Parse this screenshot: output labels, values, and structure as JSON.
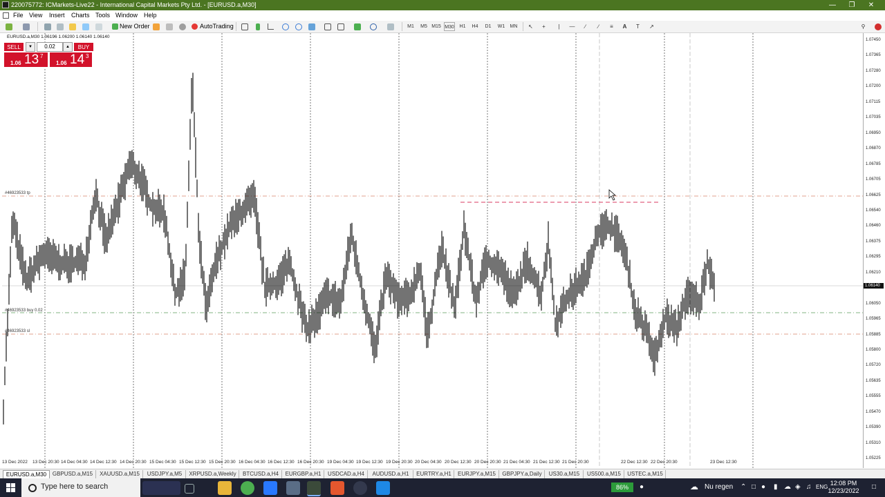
{
  "window": {
    "title": "220075772: ICMarkets-Live22 - International Capital Markets Pty Ltd. - [EURUSD.a,M30]"
  },
  "menu": [
    "File",
    "View",
    "Insert",
    "Charts",
    "Tools",
    "Window",
    "Help"
  ],
  "toolbar": {
    "new_order_label": "New Order",
    "autotrading_label": "AutoTrading",
    "timeframes": [
      "M1",
      "M5",
      "M15",
      "M30",
      "H1",
      "H4",
      "D1",
      "W1",
      "MN"
    ],
    "text_tool_label": "A"
  },
  "chart": {
    "symbol_line": "EURUSD.a,M30  1.06196 1.06200 1.06140 1.06140",
    "current_price": "1.06140",
    "price_labels": [
      "1.07450",
      "1.07365",
      "1.07280",
      "1.07200",
      "1.07115",
      "1.07035",
      "1.06950",
      "1.06870",
      "1.06785",
      "1.06705",
      "1.06625",
      "1.06540",
      "1.06460",
      "1.06375",
      "1.06295",
      "1.06210",
      "1.06130",
      "1.06050",
      "1.05965",
      "1.05885",
      "1.05800",
      "1.05720",
      "1.05635",
      "1.05555",
      "1.05470",
      "1.05390",
      "1.05310",
      "1.05225"
    ],
    "time_labels": [
      "13 Dec 2022",
      "13 Dec 20:30",
      "14 Dec 04:30",
      "14 Dec 12:30",
      "14 Dec 20:30",
      "15 Dec 04:30",
      "15 Dec 12:30",
      "15 Dec 20:30",
      "16 Dec 04:30",
      "16 Dec 12:30",
      "16 Dec 20:30",
      "19 Dec 04:30",
      "19 Dec 12:30",
      "19 Dec 20:30",
      "20 Dec 04:30",
      "20 Dec 12:30",
      "20 Dec 20:30",
      "21 Dec 04:30",
      "21 Dec 12:30",
      "21 Dec 20:30",
      "22 Dec 12:30",
      "22 Dec 20:30",
      "23 Dec 12:30"
    ],
    "order_lines": {
      "tp": "#46923533 tp",
      "buy": "#46923533 buy 0.02",
      "sl": "#46923533 sl"
    }
  },
  "one_click": {
    "sell_label": "SELL",
    "buy_label": "BUY",
    "lot": "0.02",
    "sell_prefix": "1.06",
    "sell_big": "13",
    "sell_sup": "7",
    "buy_prefix": "1.06",
    "buy_big": "14",
    "buy_sup": "3"
  },
  "tabs": [
    "EURUSD.a,M30",
    "GBPUSD.a,M15",
    "XAUUSD.a,M15",
    "USDJPY.a,M5",
    "XRPUSD.a,Weekly",
    "BTCUSD.a,H4",
    "EURGBP.a,H1",
    "USDCAD.a,H4",
    "AUDUSD.a,H1",
    "EURTRY.a,H1",
    "EURJPY.a,M15",
    "GBPJPY.a,Daily",
    "US30.a,M15",
    "US500.a,M15",
    "USTEC.a,M15"
  ],
  "taskbar": {
    "search_placeholder": "Type here to search",
    "battery": "86%",
    "weather": "Nu regen",
    "language": "ENG",
    "time": "12:08 PM",
    "date": "12/23/2022"
  },
  "colors": {
    "titlebar": "#4b7521",
    "sell": "#d2122a",
    "tp_sl_line": "#d9826a",
    "buy_line": "#5a9a5a",
    "entry_dash": "#e06080"
  }
}
